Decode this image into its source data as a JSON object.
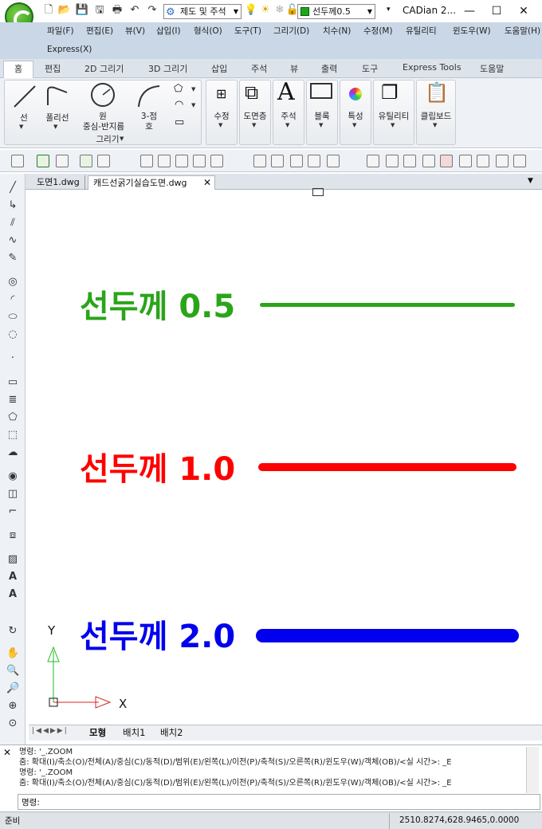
{
  "app": {
    "window_title": "CADian 2...",
    "workspace": "제도 및 주석",
    "layer": "선두께0.5",
    "layer_color": "#1aa81a"
  },
  "menubar": [
    "파일(F)",
    "편집(E)",
    "뷰(V)",
    "삽입(I)",
    "형식(O)",
    "도구(T)",
    "그리기(D)",
    "치수(N)",
    "수정(M)",
    "유틸리티",
    "윈도우(W)",
    "도움말(H)",
    "Express(X)"
  ],
  "ribbon_tabs": [
    "홈",
    "편집",
    "2D 그리기",
    "3D 그리기",
    "삽입",
    "주석",
    "뷰",
    "출력",
    "도구",
    "Express Tools",
    "도움말"
  ],
  "ribbon": {
    "draw": {
      "line": "선",
      "polyline": "폴리선",
      "circle": "원",
      "circle_sub": "중심-반지름",
      "arc": "3-점",
      "arc_sub": "호",
      "group": "그리기"
    },
    "modify": "수정",
    "layers": "도면층",
    "annotation": "주석",
    "block": "블록",
    "properties": "특성",
    "utility": "유틸리티",
    "clipboard": "클립보드"
  },
  "document_tabs": [
    "도면1.dwg",
    "캐드선굵기실습도면.dwg"
  ],
  "drawing": {
    "lines": [
      {
        "label": "선두께 0.5",
        "color": "#2aa51a"
      },
      {
        "label": "선두께 1.0",
        "color": "#ff0000"
      },
      {
        "label": "선두께 2.0",
        "color": "#0000ee"
      }
    ],
    "ucs_y": "Y",
    "ucs_x": "X"
  },
  "layout_tabs": [
    "모형",
    "배치1",
    "배치2"
  ],
  "command": {
    "lines": [
      "명령: '_.ZOOM",
      "줌:  확대(I)/축소(O)/전체(A)/중심(C)/동적(D)/범위(E)/왼쪽(L)/이전(P)/축척(S)/오른쪽(R)/윈도우(W)/객체(OB)/<실 시간>: _E",
      "명령: '_.ZOOM",
      "줌:  확대(I)/축소(O)/전체(A)/중심(C)/동적(D)/범위(E)/왼쪽(L)/이전(P)/축척(S)/오른쪽(R)/윈도우(W)/객체(OB)/<실 시간>: _E"
    ],
    "prompt": "명령:"
  },
  "status": {
    "left": "준비",
    "coords": "2510.8274,628.9465,0.0000"
  }
}
